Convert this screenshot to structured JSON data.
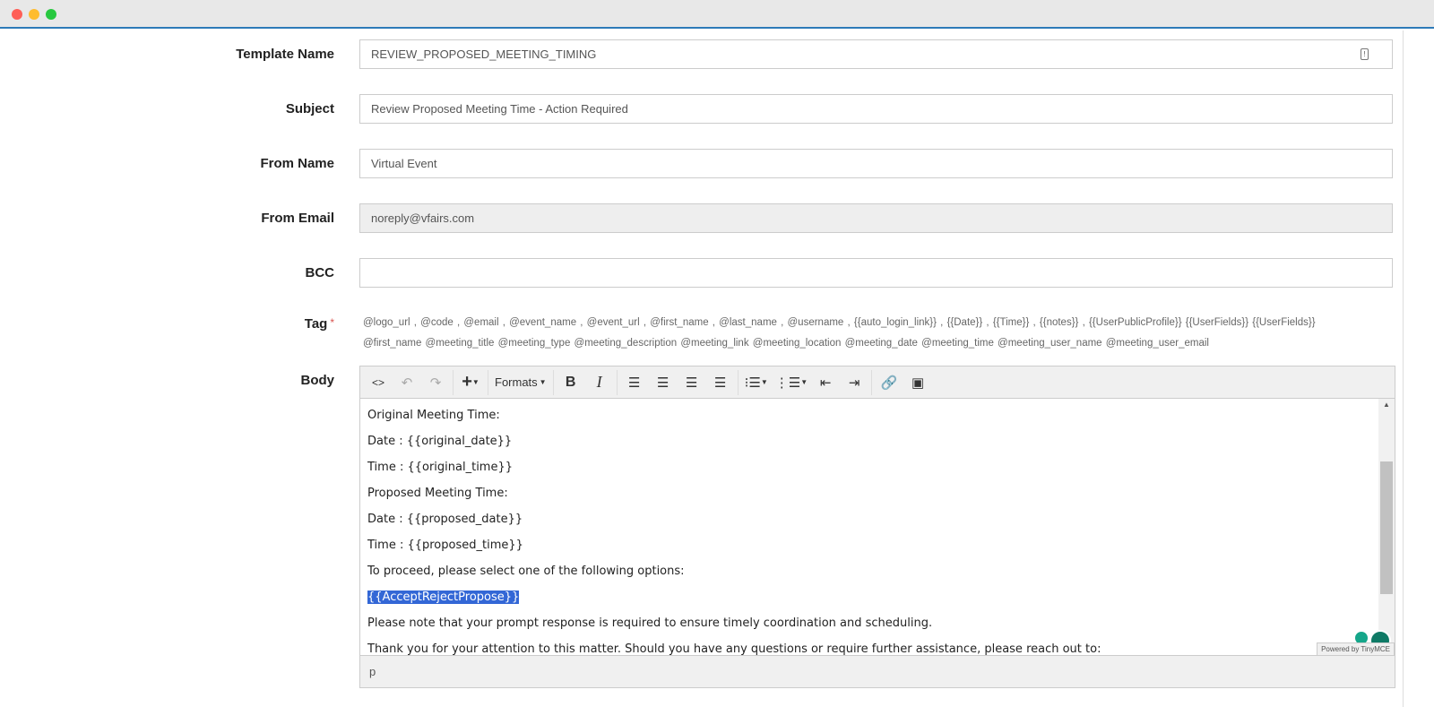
{
  "window": {
    "controls": [
      "close",
      "minimize",
      "maximize"
    ]
  },
  "form": {
    "template_name": {
      "label": "Template Name",
      "value": "REVIEW_PROPOSED_MEETING_TIMING"
    },
    "subject": {
      "label": "Subject",
      "value": "Review Proposed Meeting Time - Action Required"
    },
    "from_name": {
      "label": "From Name",
      "value": "Virtual Event"
    },
    "from_email": {
      "label": "From Email",
      "value": "noreply@vfairs.com"
    },
    "bcc": {
      "label": "BCC",
      "value": ""
    },
    "tag": {
      "label": "Tag",
      "required": "*",
      "line1": "@logo_url ,  @code ,  @email ,  @event_name ,  @event_url ,  @first_name ,  @last_name ,  @username ,  {{auto_login_link}} ,  {{Date}} ,  {{Time}} ,  {{notes}} ,  {{UserPublicProfile}}  {{UserFields}}  {{UserFields}}",
      "line2": "@first_name  @meeting_title  @meeting_type  @meeting_description  @meeting_link  @meeting_location  @meeting_date  @meeting_time  @meeting_user_name  @meeting_user_email"
    },
    "body": {
      "label": "Body"
    }
  },
  "editor": {
    "toolbar": {
      "formats": "Formats"
    },
    "lines": [
      "Original Meeting Time:",
      "Date : {{original_date}}",
      "Time : {{original_time}}",
      "Proposed Meeting Time:",
      "Date : {{proposed_date}}",
      "Time : {{proposed_time}}",
      "To proceed, please select one of the following options:",
      "{{AcceptRejectPropose}}",
      "Please note that your prompt response is required to ensure timely coordination and scheduling.",
      "Thank you for your attention to this matter. Should you have any questions or require further assistance, please reach out to:"
    ],
    "status_path": "p",
    "powered": "Powered by TinyMCE"
  }
}
